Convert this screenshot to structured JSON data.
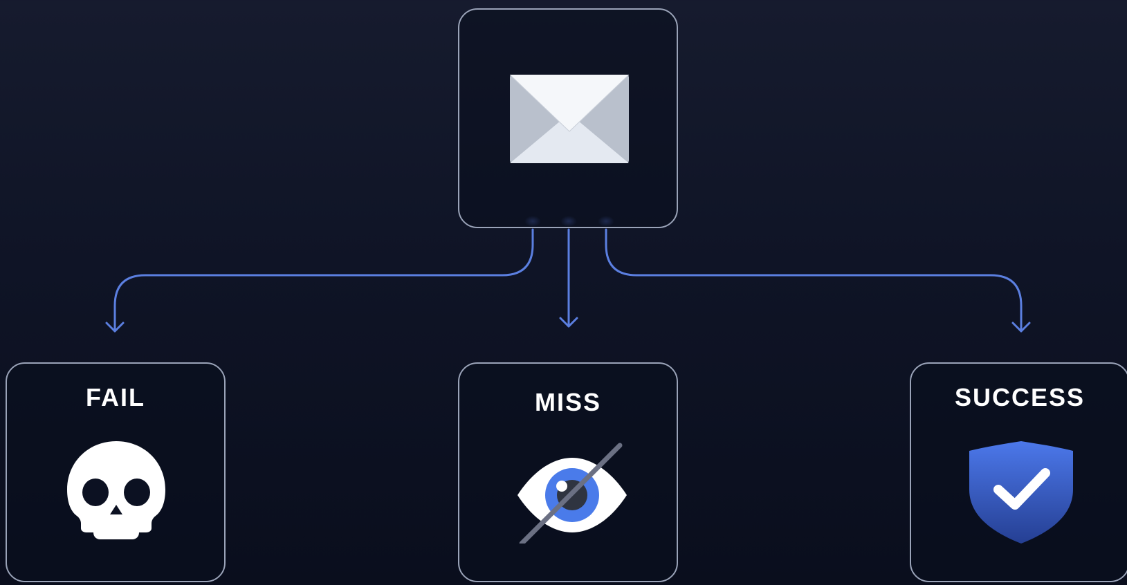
{
  "colors": {
    "connector": "#5b7fe0",
    "card_border": "#9aa3b8",
    "label": "#ffffff",
    "background_top": "#161b2e",
    "background_bottom": "#0a0e1d"
  },
  "source_node": {
    "icon": "envelope-icon"
  },
  "outcomes": [
    {
      "label": "FAIL",
      "icon": "skull-icon"
    },
    {
      "label": "MISS",
      "icon": "eye-slash-icon"
    },
    {
      "label": "SUCCESS",
      "icon": "shield-check-icon"
    }
  ]
}
